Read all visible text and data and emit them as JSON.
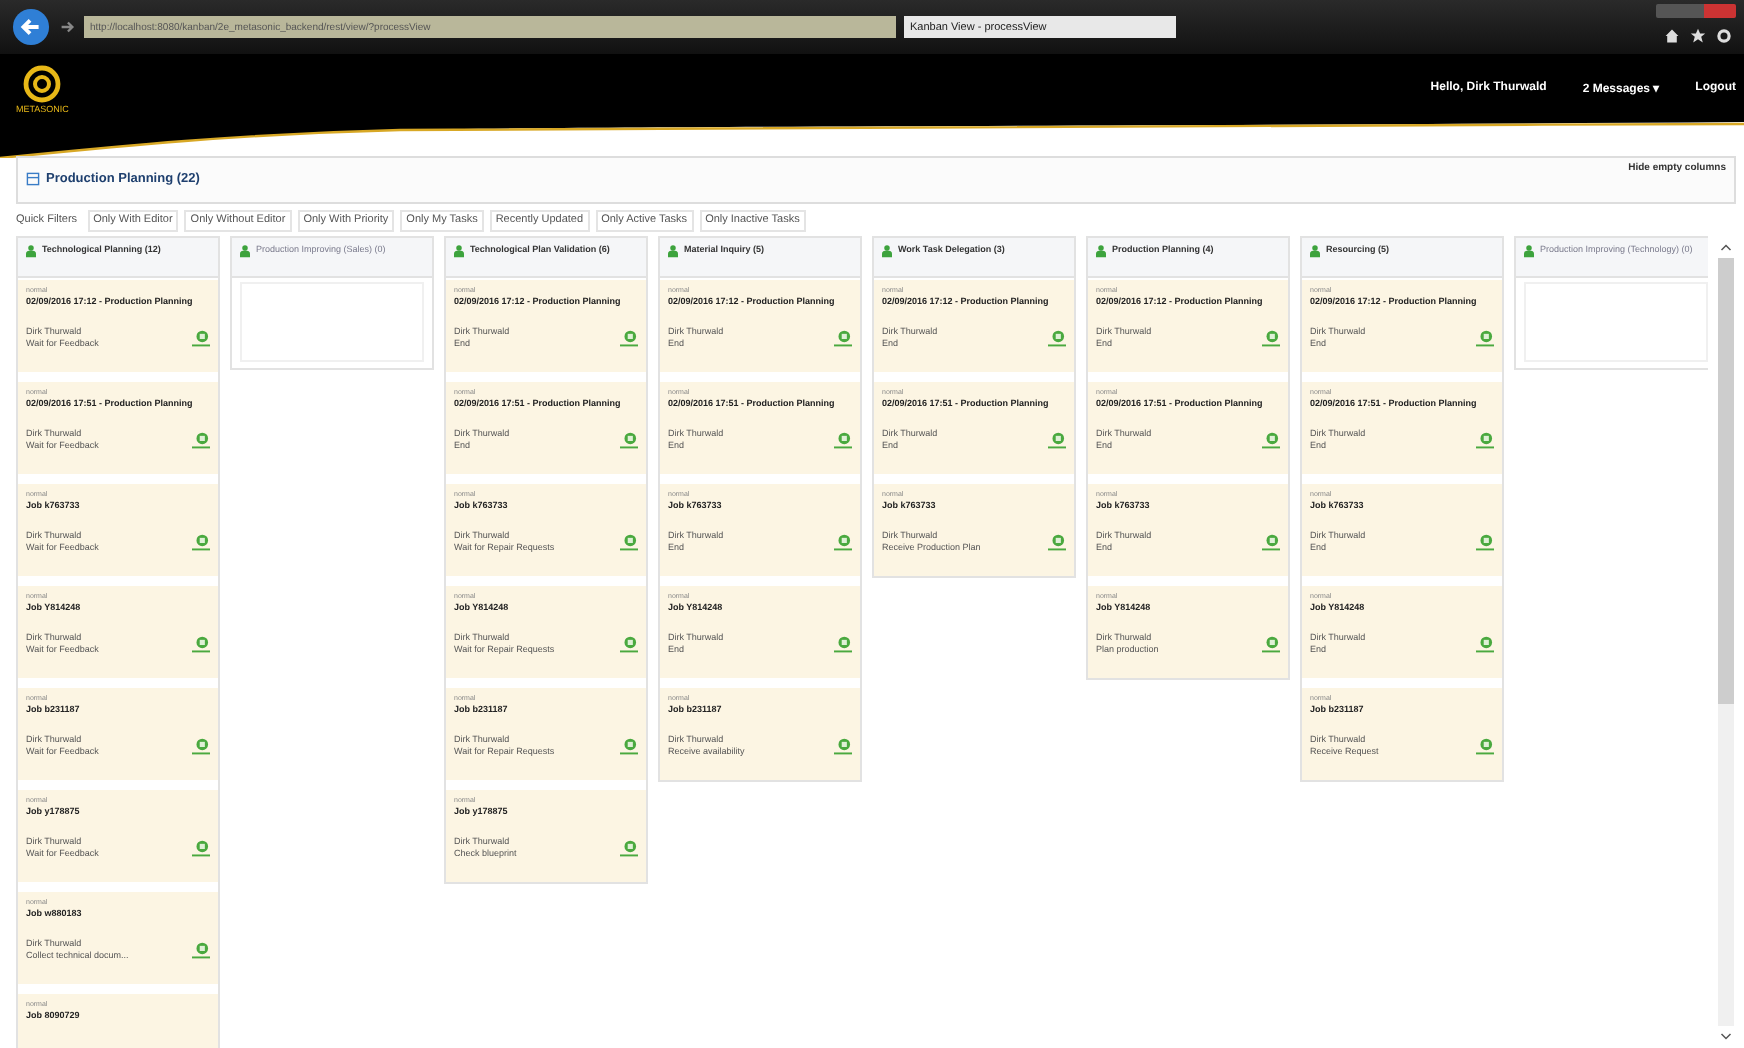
{
  "browser": {
    "url": "http://localhost:8080/kanban/2e_metasonic_backend/rest/view/?processView",
    "tab": "Kanban View - processView"
  },
  "header": {
    "logo": "METASONIC",
    "greeting": "Hello, Dirk Thurwald",
    "messages": "2 Messages ▾",
    "logout": "Logout"
  },
  "board": {
    "title": "Production Planning (22)",
    "hide_empty": "Hide empty columns"
  },
  "quick_filters": {
    "label": "Quick Filters",
    "items": [
      "Only With Editor",
      "Only Without Editor",
      "Only With Priority",
      "Only My Tasks",
      "Recently Updated",
      "Only Active Tasks",
      "Only Inactive Tasks"
    ]
  },
  "columns": [
    {
      "title": "Technological Planning (12)",
      "cards": [
        {
          "priority": "normal",
          "title": "02/09/2016 17:12 - Production Planning",
          "person": "Dirk Thurwald",
          "state": "Wait for Feedback"
        },
        {
          "priority": "normal",
          "title": "02/09/2016 17:51 - Production Planning",
          "person": "Dirk Thurwald",
          "state": "Wait for Feedback"
        },
        {
          "priority": "normal",
          "title": "Job k763733",
          "person": "Dirk Thurwald",
          "state": "Wait for Feedback"
        },
        {
          "priority": "normal",
          "title": "Job Y814248",
          "person": "Dirk Thurwald",
          "state": "Wait for Feedback"
        },
        {
          "priority": "normal",
          "title": "Job b231187",
          "person": "Dirk Thurwald",
          "state": "Wait for Feedback"
        },
        {
          "priority": "normal",
          "title": "Job y178875",
          "person": "Dirk Thurwald",
          "state": "Wait for Feedback"
        },
        {
          "priority": "normal",
          "title": "Job w880183",
          "person": "Dirk Thurwald",
          "state": "Collect technical docum..."
        },
        {
          "priority": "normal",
          "title": "Job 8090729"
        }
      ]
    },
    {
      "title": "Production Improving (Sales) (0)"
    },
    {
      "title": "Technological Plan Validation (6)",
      "cards": [
        {
          "priority": "normal",
          "title": "02/09/2016 17:12 - Production Planning",
          "person": "Dirk Thurwald",
          "state": "End"
        },
        {
          "priority": "normal",
          "title": "02/09/2016 17:51 - Production Planning",
          "person": "Dirk Thurwald",
          "state": "End"
        },
        {
          "priority": "normal",
          "title": "Job k763733",
          "person": "Dirk Thurwald",
          "state": "Wait for Repair Requests"
        },
        {
          "priority": "normal",
          "title": "Job Y814248",
          "person": "Dirk Thurwald",
          "state": "Wait for Repair Requests"
        },
        {
          "priority": "normal",
          "title": "Job b231187",
          "person": "Dirk Thurwald",
          "state": "Wait for Repair Requests"
        },
        {
          "priority": "normal",
          "title": "Job y178875",
          "person": "Dirk Thurwald",
          "state": "Check blueprint"
        }
      ]
    },
    {
      "title": "Material Inquiry (5)",
      "cards": [
        {
          "priority": "normal",
          "title": "02/09/2016 17:12 - Production Planning",
          "person": "Dirk Thurwald",
          "state": "End"
        },
        {
          "priority": "normal",
          "title": "02/09/2016 17:51 - Production Planning",
          "person": "Dirk Thurwald",
          "state": "End"
        },
        {
          "priority": "normal",
          "title": "Job k763733",
          "person": "Dirk Thurwald",
          "state": "End"
        },
        {
          "priority": "normal",
          "title": "Job Y814248",
          "person": "Dirk Thurwald",
          "state": "End"
        },
        {
          "priority": "normal",
          "title": "Job b231187",
          "person": "Dirk Thurwald",
          "state": "Receive availability"
        }
      ]
    },
    {
      "title": "Work Task Delegation (3)",
      "cards": [
        {
          "priority": "normal",
          "title": "02/09/2016 17:12 - Production Planning",
          "person": "Dirk Thurwald",
          "state": "End"
        },
        {
          "priority": "normal",
          "title": "02/09/2016 17:51 - Production Planning",
          "person": "Dirk Thurwald",
          "state": "End"
        },
        {
          "priority": "normal",
          "title": "Job k763733",
          "person": "Dirk Thurwald",
          "state": "Receive Production Plan"
        }
      ]
    },
    {
      "title": "Production Planning (4)",
      "cards": [
        {
          "priority": "normal",
          "title": "02/09/2016 17:12 - Production Planning",
          "person": "Dirk Thurwald",
          "state": "End"
        },
        {
          "priority": "normal",
          "title": "02/09/2016 17:51 - Production Planning",
          "person": "Dirk Thurwald",
          "state": "End"
        },
        {
          "priority": "normal",
          "title": "Job k763733",
          "person": "Dirk Thurwald",
          "state": "End"
        },
        {
          "priority": "normal",
          "title": "Job Y814248",
          "person": "Dirk Thurwald",
          "state": "Plan production"
        }
      ]
    },
    {
      "title": "Resourcing (5)",
      "cards": [
        {
          "priority": "normal",
          "title": "02/09/2016 17:12 - Production Planning",
          "person": "Dirk Thurwald",
          "state": "End"
        },
        {
          "priority": "normal",
          "title": "02/09/2016 17:51 - Production Planning",
          "person": "Dirk Thurwald",
          "state": "End"
        },
        {
          "priority": "normal",
          "title": "Job k763733",
          "person": "Dirk Thurwald",
          "state": "End"
        },
        {
          "priority": "normal",
          "title": "Job Y814248",
          "person": "Dirk Thurwald",
          "state": "End"
        },
        {
          "priority": "normal",
          "title": "Job b231187",
          "person": "Dirk Thurwald",
          "state": "Receive Request"
        }
      ]
    },
    {
      "title": "Production Improving (Technology) (0)"
    }
  ]
}
